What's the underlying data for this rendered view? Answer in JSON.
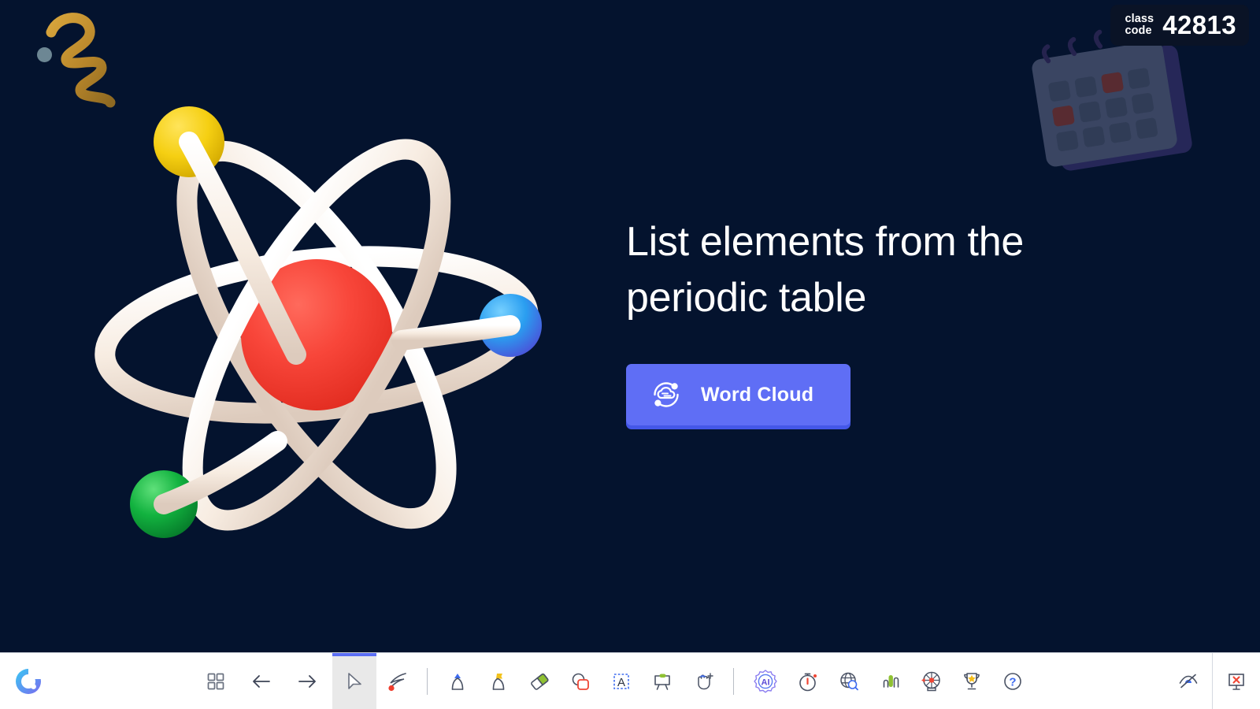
{
  "app": {
    "name": "ClassPoint",
    "logo_icon": "classpoint-c-logo",
    "background_color": "#04132e",
    "accent_color": "#5f6ef5"
  },
  "class_code": {
    "label_line1": "class",
    "label_line2": "code",
    "value": "42813"
  },
  "slide": {
    "title": "List elements from the periodic table",
    "illustration": "atom-3d-illustration",
    "decorations": [
      {
        "name": "squiggle-doodle",
        "color": "#c08f2e"
      },
      {
        "name": "dot-doodle",
        "color": "#6d8794"
      },
      {
        "name": "calendar-3d-illustration",
        "color": "#5a6b7d"
      }
    ],
    "atom": {
      "nucleus_color": "#f5453a",
      "orbit_color": "#f6ece2",
      "electrons": [
        {
          "name": "electron-yellow",
          "color": "#f5d013"
        },
        {
          "name": "electron-blue",
          "color": "#2a9ef0"
        },
        {
          "name": "electron-green",
          "color": "#12b23f"
        }
      ]
    },
    "cta": {
      "label": "Word Cloud",
      "icon": "word-cloud-icon",
      "background": "#5f6ef5",
      "shadow": "#4457e8"
    }
  },
  "toolbar": {
    "logo": {
      "name": "classpoint-logo",
      "label": "ClassPoint"
    },
    "items": [
      {
        "name": "slide-grid-button",
        "icon": "grid-icon",
        "label": "Slide overview",
        "active": false
      },
      {
        "name": "previous-slide-button",
        "icon": "arrow-left-icon",
        "label": "Previous slide",
        "active": false
      },
      {
        "name": "next-slide-button",
        "icon": "arrow-right-icon",
        "label": "Next slide",
        "active": false
      },
      {
        "name": "select-tool-button",
        "icon": "cursor-icon",
        "label": "Select",
        "active": true
      },
      {
        "name": "laser-pointer-button",
        "icon": "laser-pointer-icon",
        "label": "Laser pointer",
        "active": false
      },
      {
        "name": "pen-tool-button",
        "icon": "pen-icon",
        "label": "Pen",
        "active": false
      },
      {
        "name": "highlighter-tool-button",
        "icon": "highlighter-icon",
        "label": "Highlighter",
        "active": false
      },
      {
        "name": "eraser-tool-button",
        "icon": "eraser-icon",
        "label": "Eraser",
        "active": false
      },
      {
        "name": "shapes-tool-button",
        "icon": "shapes-icon",
        "label": "Shapes",
        "active": false
      },
      {
        "name": "text-box-button",
        "icon": "text-box-icon",
        "label": "Text box",
        "active": false
      },
      {
        "name": "whiteboard-button",
        "icon": "whiteboard-icon",
        "label": "Whiteboard",
        "active": false
      },
      {
        "name": "drag-tool-button",
        "icon": "drag-hand-icon",
        "label": "Drag objects",
        "active": false
      },
      {
        "name": "ai-assistant-button",
        "icon": "ai-icon",
        "label": "AI",
        "active": false
      },
      {
        "name": "timer-button",
        "icon": "timer-icon",
        "label": "Timer",
        "active": false
      },
      {
        "name": "embedded-browser-button",
        "icon": "browser-globe-icon",
        "label": "Embedded browser",
        "active": false
      },
      {
        "name": "quick-poll-button",
        "icon": "bar-chart-icon",
        "label": "Quick poll",
        "active": false
      },
      {
        "name": "name-picker-button",
        "icon": "picker-wheel-icon",
        "label": "Name picker",
        "active": false
      },
      {
        "name": "leaderboard-button",
        "icon": "trophy-icon",
        "label": "Leaderboard",
        "active": false
      },
      {
        "name": "help-button",
        "icon": "question-mark-icon",
        "label": "Help",
        "active": false
      }
    ],
    "tail_items": [
      {
        "name": "hide-toolbar-button",
        "icon": "eye-slash-icon",
        "label": "Hide"
      },
      {
        "name": "exit-presentation-button",
        "icon": "exit-slideshow-icon",
        "label": "End show"
      }
    ]
  }
}
